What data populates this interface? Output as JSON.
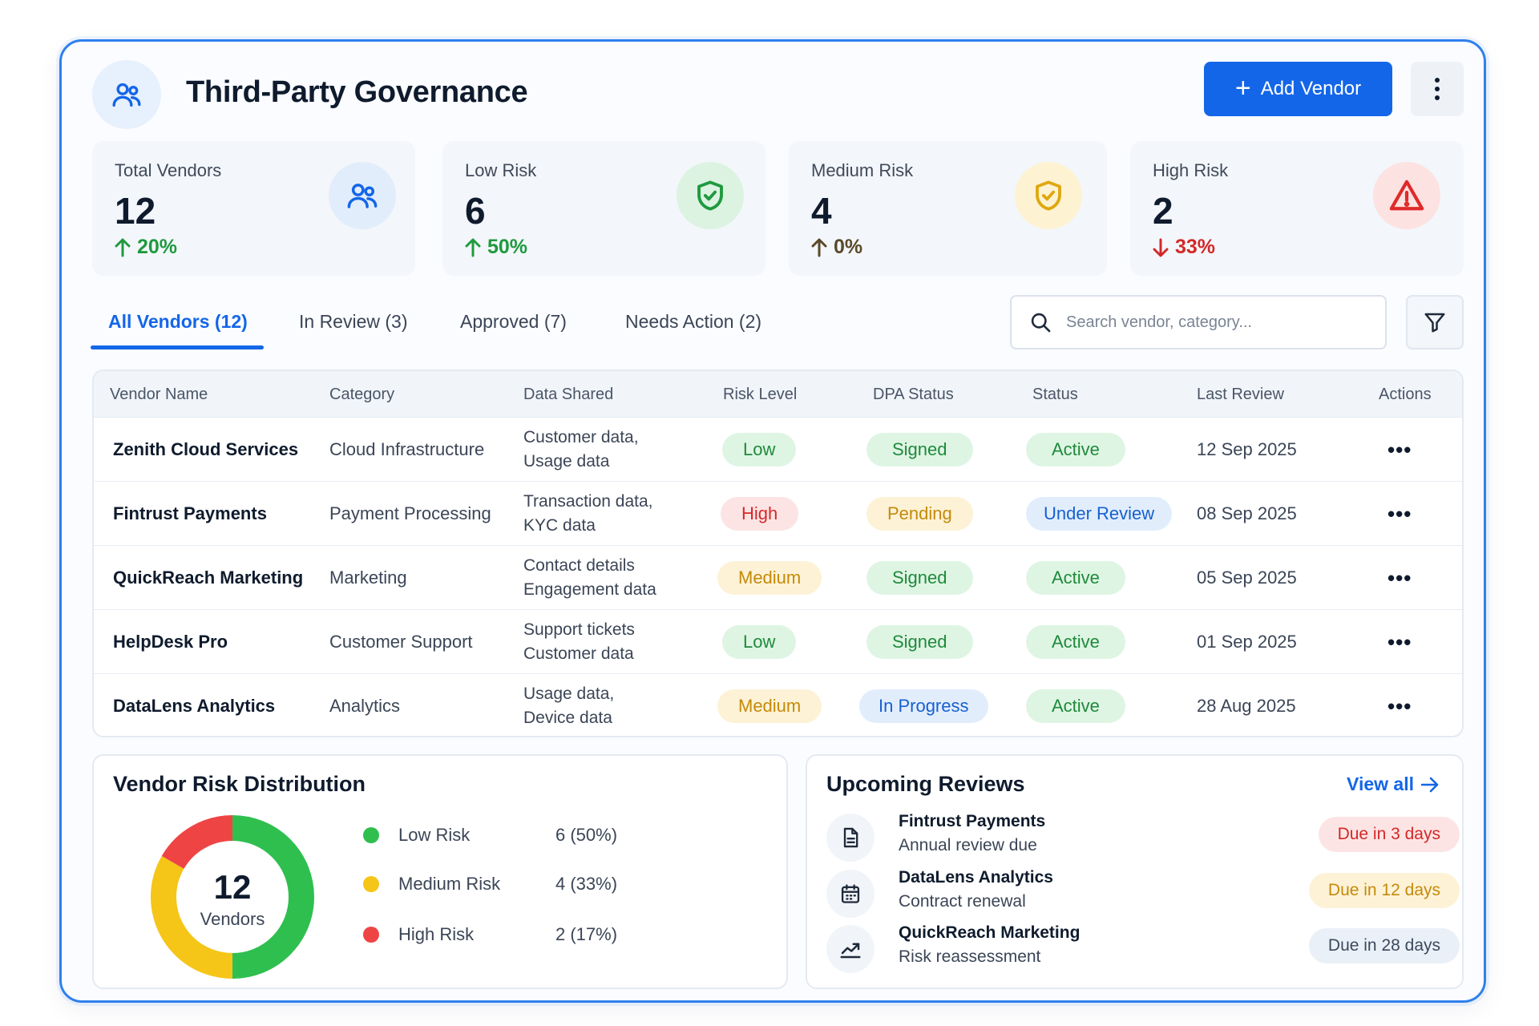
{
  "header": {
    "title": "Third-Party Governance",
    "add_label": "Add Vendor"
  },
  "stats": [
    {
      "label": "Total Vendors",
      "value": "12",
      "trend": "20%",
      "trend_dir": "up",
      "trend_color": "#1e9a3e",
      "icon": "users-icon"
    },
    {
      "label": "Low Risk",
      "value": "6",
      "trend": "50%",
      "trend_dir": "up",
      "trend_color": "#1e9a3e",
      "icon": "shield-check-icon"
    },
    {
      "label": "Medium Risk",
      "value": "4",
      "trend": "0%",
      "trend_dir": "up",
      "trend_color": "#5a4a2a",
      "icon": "shield-check-icon"
    },
    {
      "label": "High Risk",
      "value": "2",
      "trend": "33%",
      "trend_dir": "down",
      "trend_color": "#d42828",
      "icon": "warning-triangle-icon"
    }
  ],
  "tabs": [
    {
      "label": "All Vendors (12)",
      "active": true
    },
    {
      "label": "In Review (3)",
      "active": false
    },
    {
      "label": "Approved (7)",
      "active": false
    },
    {
      "label": "Needs Action (2)",
      "active": false
    }
  ],
  "search": {
    "placeholder": "Search vendor, category...",
    "value": ""
  },
  "table": {
    "columns": [
      "Vendor Name",
      "Category",
      "Data Shared",
      "Risk Level",
      "DPA Status",
      "Status",
      "Last Review",
      "Actions"
    ],
    "rows": [
      {
        "vendor": "Zenith Cloud Services",
        "category": "Cloud Infrastructure",
        "data1": "Customer data,",
        "data2": "Usage data",
        "risk": "Low",
        "dpa": "Signed",
        "status": "Active",
        "last_review": "12 Sep 2025",
        "action": "•••"
      },
      {
        "vendor": "Fintrust Payments",
        "category": "Payment Processing",
        "data1": "Transaction data,",
        "data2": "KYC data",
        "risk": "High",
        "dpa": "Pending",
        "status": "Under Review",
        "last_review": "08 Sep 2025",
        "action": "•••"
      },
      {
        "vendor": "QuickReach Marketing",
        "category": "Marketing",
        "data1": "Contact details",
        "data2": "Engagement data",
        "risk": "Medium",
        "dpa": "Signed",
        "status": "Active",
        "last_review": "05 Sep 2025",
        "action": "•••"
      },
      {
        "vendor": "HelpDesk Pro",
        "category": "Customer Support",
        "data1": "Support tickets",
        "data2": "Customer data",
        "risk": "Low",
        "dpa": "Signed",
        "status": "Active",
        "last_review": "01 Sep 2025",
        "action": "•••"
      },
      {
        "vendor": "DataLens Analytics",
        "category": "Analytics",
        "data1": "Usage data,",
        "data2": "Device data",
        "risk": "Medium",
        "dpa": "In Progress",
        "status": "Active",
        "last_review": "28 Aug 2025",
        "action": "•••"
      }
    ]
  },
  "distribution": {
    "title": "Vendor Risk Distribution",
    "center_value": "12",
    "center_label": "Vendors",
    "items": [
      {
        "label": "Low Risk",
        "value": "6 (50%)",
        "count": 6,
        "color": "#2fbf4f"
      },
      {
        "label": "Medium Risk",
        "value": "4 (33%)",
        "count": 4,
        "color": "#f5c518"
      },
      {
        "label": "High Risk",
        "value": "2 (17%)",
        "count": 2,
        "color": "#ef4444"
      }
    ]
  },
  "reviews": {
    "title": "Upcoming Reviews",
    "view_all": "View all",
    "items": [
      {
        "title": "Fintrust Payments",
        "sub": "Annual review due",
        "due": "Due in 3 days",
        "icon": "document-icon",
        "due_bg": "#fde4e4",
        "due_fg": "#d42828"
      },
      {
        "title": "DataLens Analytics",
        "sub": "Contract renewal",
        "due": "Due in 12 days",
        "icon": "calendar-icon",
        "due_bg": "#fdf2d6",
        "due_fg": "#c48a0a"
      },
      {
        "title": "QuickReach Marketing",
        "sub": "Risk reassessment",
        "due": "Due in 28 days",
        "icon": "trend-chart-icon",
        "due_bg": "#eaf0f7",
        "due_fg": "#3b4a5e"
      }
    ]
  }
}
